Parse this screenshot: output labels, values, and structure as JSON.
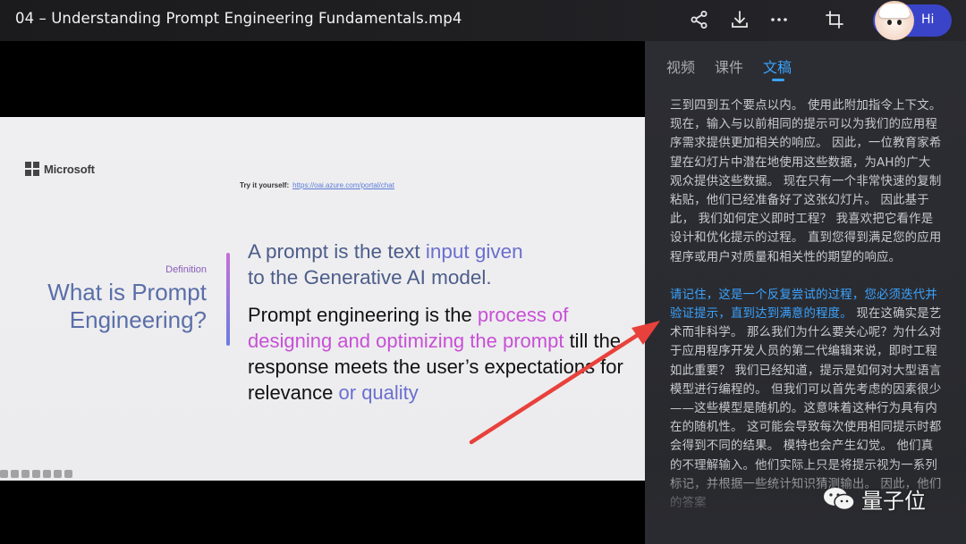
{
  "window": {
    "title": "04 – Understanding Prompt Engineering Fundamentals.mp4",
    "ai_assistant_label": "Hi"
  },
  "toolbar": {
    "icons": [
      "share-icon",
      "download-icon",
      "more-icon",
      "crop-icon"
    ]
  },
  "slide": {
    "brand": "Microsoft",
    "try_label": "Try it yourself:",
    "try_link": "https://oai.azure.com/portal/chat",
    "definition_label": "Definition",
    "heading": "What is Prompt Engineering?",
    "p1_plain": "A prompt is the text ",
    "p1_hl": "input given",
    "p1_tail": "to the Generative AI model.",
    "p2_plain": "Prompt engineering is the ",
    "p2_pink": "process of designing and optimizing the prompt",
    "p2_mid": " till the response meets the user’s expectations for relevance ",
    "p2_blue": "or quality"
  },
  "panel": {
    "tabs": [
      {
        "label": "视频",
        "active": false
      },
      {
        "label": "课件",
        "active": false
      },
      {
        "label": "文稿",
        "active": true
      }
    ],
    "paragraph1": "三到四到五个要点以内。 使用此附加指令上下文。 现在，输入与以前相同的提示可以为我们的应用程序需求提供更加相关的响应。 因此，一位教育家希望在幻灯片中潜在地使用这些数据，为AH的广大观众提供这些数据。 现在只有一个非常快速的复制粘贴，他们已经准备好了这张幻灯片。 因此基于此， 我们如何定义即时工程？ 我喜欢把它看作是设计和优化提示的过程。 直到您得到满足您的应用程序或用户对质量和相关性的期望的响应。",
    "paragraph2_highlight": "请记住，这是一个反复尝试的过程，您必须迭代并验证提示，直到达到满意的程度。",
    "paragraph2_rest": " 现在这确实是艺术而非科学。 那么我们为什么要关心呢？为什么对于应用程序开发人员的第二代编辑来说，即时工程如此重要？ 我们已经知道，提示是如何对大型语言模型进行编程的。 但我们可以首先考虑的因素很少——这些模型是随机的。这意味着这种行为具有内在的随机性。 这可能会导致每次使用相同提示时都会得到不同的结果。 模特也会产生幻觉。 他们真的不理解输入。他们实际上只是将提示视为一系列标记，并根据一些统计知识猜测输出。 因此，他们的答案",
    "watermark": "量子位"
  },
  "colors": {
    "accent": "#3aa3ff",
    "annotation_arrow": "#e8413b",
    "ai_pill": "#3a44c9"
  }
}
